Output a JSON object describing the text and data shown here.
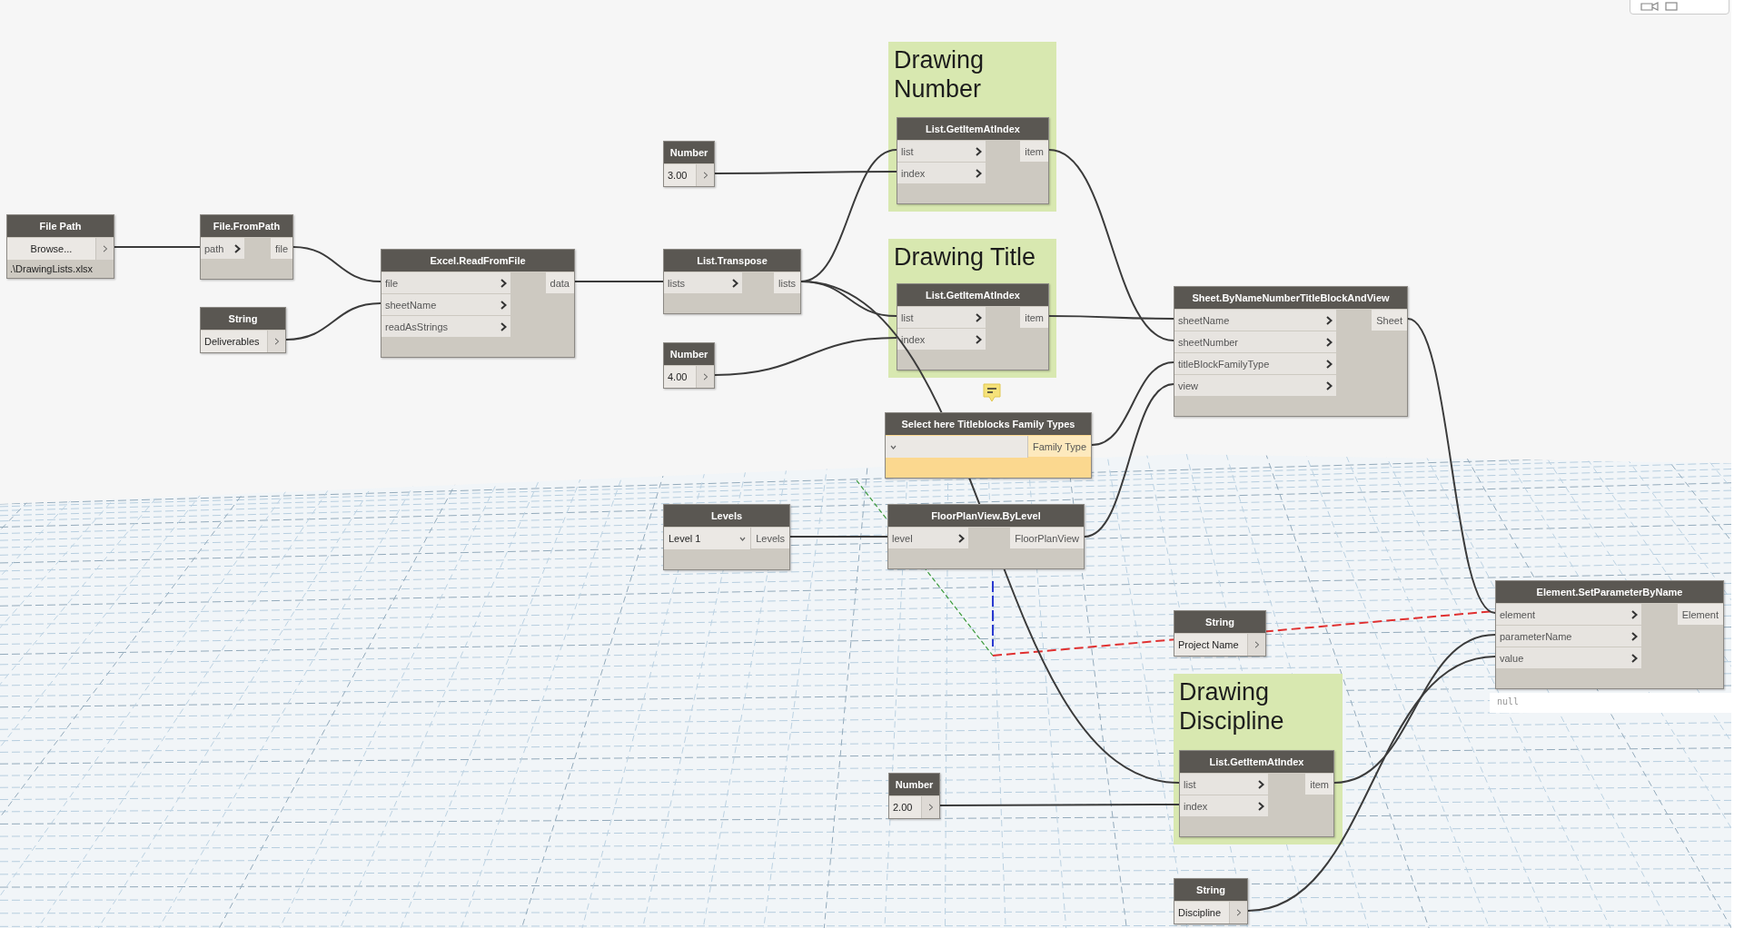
{
  "nodes": [
    {
      "kind": "file_path",
      "title": "File Path",
      "button": "Browse...",
      "path": ".\\DrawingLists.xlsx",
      "warning": false
    },
    {
      "kind": "function",
      "title": "File.FromPath",
      "inputs": [
        "path"
      ],
      "outputs": [
        "file"
      ],
      "warning": false
    },
    {
      "kind": "value",
      "title": "String",
      "value": "Deliverables",
      "warning": false
    },
    {
      "kind": "function",
      "title": "Excel.ReadFromFile",
      "inputs": [
        "file",
        "sheetName",
        "readAsStrings"
      ],
      "outputs": [
        "data"
      ],
      "warning": false
    },
    {
      "kind": "value",
      "title": "Number",
      "value": "3.00",
      "warning": false
    },
    {
      "kind": "function",
      "title": "List.Transpose",
      "inputs": [
        "lists"
      ],
      "outputs": [
        "lists"
      ],
      "warning": false
    },
    {
      "kind": "value",
      "title": "Number",
      "value": "4.00",
      "warning": false
    },
    {
      "kind": "group",
      "title": "Drawing Number",
      "node": {
        "kind": "function",
        "title": "List.GetItemAtIndex",
        "inputs": [
          "list",
          "index"
        ],
        "outputs": [
          "item"
        ],
        "warning": false
      }
    },
    {
      "kind": "group",
      "title": "Drawing Title",
      "node": {
        "kind": "function",
        "title": "List.GetItemAtIndex",
        "inputs": [
          "list",
          "index"
        ],
        "outputs": [
          "item"
        ],
        "warning": false
      }
    },
    {
      "kind": "dropdown",
      "title": "Select here Titleblocks Family Types",
      "outputs": [
        "Family Type"
      ],
      "warning": true
    },
    {
      "kind": "dropdown",
      "title": "Levels",
      "selection": "Level 1",
      "outputs": [
        "Levels"
      ],
      "warning": false
    },
    {
      "kind": "function",
      "title": "FloorPlanView.ByLevel",
      "inputs": [
        "level"
      ],
      "outputs": [
        "FloorPlanView"
      ],
      "warning": false
    },
    {
      "kind": "function",
      "title": "Sheet.ByNameNumberTitleBlockAndView",
      "inputs": [
        "sheetName",
        "sheetNumber",
        "titleBlockFamilyType",
        "view"
      ],
      "outputs": [
        "Sheet"
      ],
      "warning": false
    },
    {
      "kind": "value",
      "title": "String",
      "value": "Project Name",
      "warning": false
    },
    {
      "kind": "function",
      "title": "Element.SetParameterByName",
      "inputs": [
        "element",
        "parameterName",
        "value"
      ],
      "outputs": [
        "Element"
      ],
      "preview": "null",
      "warning": false
    },
    {
      "kind": "value",
      "title": "Number",
      "value": "2.00",
      "warning": false
    },
    {
      "kind": "group",
      "title": "Drawing Discipline",
      "node": {
        "kind": "function",
        "title": "List.GetItemAtIndex",
        "inputs": [
          "list",
          "index"
        ],
        "outputs": [
          "item"
        ],
        "warning": false
      }
    },
    {
      "kind": "value",
      "title": "String",
      "value": "Discipline",
      "warning": false
    }
  ]
}
